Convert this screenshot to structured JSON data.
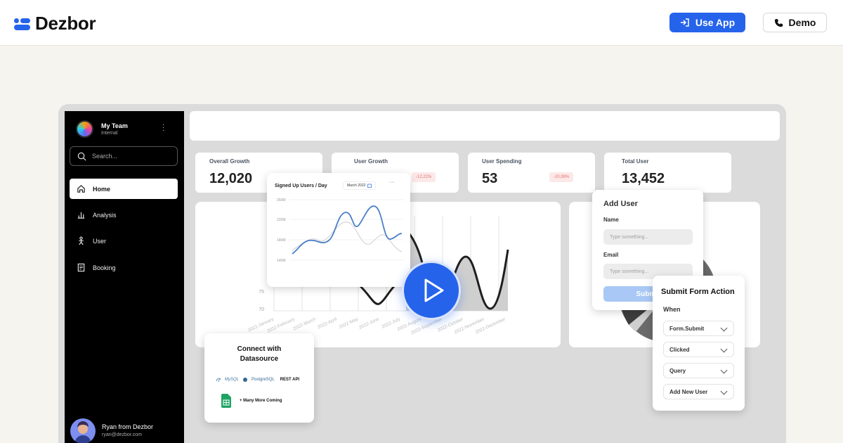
{
  "brand": {
    "name": "Dezbor",
    "color": "#2563eb"
  },
  "nav": {
    "use_app_label": "Use App",
    "demo_label": "Demo"
  },
  "sidebar": {
    "team_name": "My Team",
    "team_sub": "Internal",
    "search_placeholder": "Search...",
    "items": [
      {
        "label": "Home",
        "icon": "home-icon",
        "active": true
      },
      {
        "label": "Analysis",
        "icon": "bar-chart-icon",
        "active": false
      },
      {
        "label": "User",
        "icon": "user-icon",
        "active": false
      },
      {
        "label": "Booking",
        "icon": "book-icon",
        "active": false
      }
    ],
    "user_name": "Ryan from Dezbor",
    "user_email": "ryan@dezbor.com"
  },
  "stats": [
    {
      "label": "Overall Growth",
      "value": "12,020"
    },
    {
      "label": "User Growth",
      "value": "",
      "badge": "-12,22%"
    },
    {
      "label": "User Spending",
      "value": "53",
      "badge": "-20,99%"
    },
    {
      "label": "Total User",
      "value": "13,452"
    }
  ],
  "big_chart": {
    "y_ticks": [
      "75",
      "70"
    ],
    "x_ticks": [
      "2022-January",
      "2022-February",
      "2022-March",
      "2022-April",
      "2022-May",
      "2022-June",
      "2022-July",
      "2022-August",
      "2022-September",
      "2022-October",
      "2022-November",
      "2022-December"
    ]
  },
  "mini_chart": {
    "title": "Signed Up Users / Day",
    "date": "March 2022",
    "y_ticks": [
      "260M",
      "220M",
      "180M",
      "140M"
    ],
    "series_color": "#4a7fc9"
  },
  "datasource": {
    "title_line1": "Connect with",
    "title_line2": "Datasource",
    "sources": [
      "MySQL",
      "PostgreSQL",
      "REST API"
    ],
    "more": "+ Many More Coming"
  },
  "add_user": {
    "title": "Add User",
    "name_label": "Name",
    "name_placeholder": "Type something...",
    "email_label": "Email",
    "email_placeholder": "Type something...",
    "submit_label": "Submit"
  },
  "form_action": {
    "title": "Submit Form Action",
    "when_label": "When",
    "options": [
      "Form.Submit",
      "Clicked",
      "Query",
      "Add New User"
    ]
  }
}
